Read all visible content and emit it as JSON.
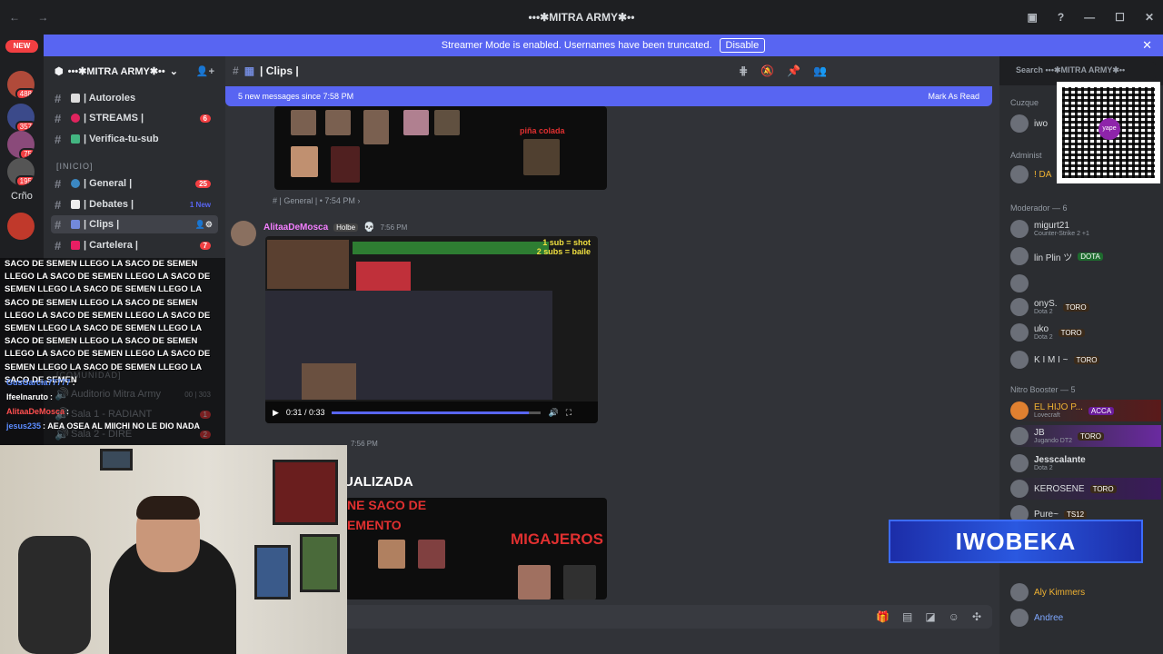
{
  "window": {
    "title": "•••✱MITRA ARMY✱••",
    "back": "←",
    "forward": "→"
  },
  "banner": {
    "text": "Streamer Mode is enabled. Usernames have been truncated.",
    "button": "Disable",
    "close": "✕"
  },
  "rail": {
    "new_label": "NEW",
    "servers": [
      {
        "badge": "488"
      },
      {
        "badge": "357"
      },
      {
        "badge": "75"
      },
      {
        "badge": "195"
      },
      {
        "label": "Crño"
      }
    ]
  },
  "guild": {
    "name": "•••✱MITRA ARMY✱••"
  },
  "channels": [
    {
      "name": "| Autoroles",
      "count": "",
      "new": ""
    },
    {
      "name": "| STREAMS |",
      "count": "6",
      "new": ""
    },
    {
      "name": "| Verifica-tu-sub",
      "count": "",
      "new": ""
    },
    {
      "name": "| General |",
      "count": "25",
      "new": ""
    },
    {
      "name": "| Debates |",
      "count": "",
      "new": "1 New"
    },
    {
      "name": "| Clips |",
      "count": "",
      "new": ""
    },
    {
      "name": "| Cartelera |",
      "count": "7",
      "new": ""
    }
  ],
  "categories": {
    "inicio": "[INICIO]",
    "comunidad": "[COMUNIDAD]"
  },
  "voice": [
    {
      "name": "Auditorio Mitra Army",
      "count": "00 | 303"
    },
    {
      "name": "Sala 1 - RADIANT",
      "count": "1"
    },
    {
      "name": "Sala 2 - DIRE",
      "count": "2"
    }
  ],
  "header": {
    "channel": "| Clips |",
    "search_placeholder": "Search •••✱MITRA ARMY✱••"
  },
  "new_messages": {
    "text": "5 new messages since 7:58 PM",
    "mark": "Mark As Read"
  },
  "messages": {
    "pina": "piña colada",
    "channel_link": "# | General | • 7:54 PM ›",
    "author": "AlitaaDeMosca",
    "author_tag": "Holbe",
    "time": "7:56 PM",
    "video_time": "0:31 / 0:33",
    "video_overlay_1": "1 sub = shot",
    "video_overlay_2": "2 subs = baile",
    "second_time": "7:56 PM",
    "second_heading": "UALIZADA",
    "second_sub": "NE SACO DE",
    "second_sub2": "EMENTO",
    "migajeros": "MIGAJEROS"
  },
  "members": {
    "categories": {
      "cuzquen": "Cuzque",
      "admin": "Administ",
      "mod": "Moderador — 6",
      "nitro": "Nitro Booster — 5"
    },
    "list": [
      {
        "name": "iwo",
        "sub": "",
        "tag": ""
      },
      {
        "name": "! DA",
        "sub": "",
        "tag": ""
      },
      {
        "name": "migurt21",
        "sub": "Counter-Strike 2 +1",
        "tag": ""
      },
      {
        "name": "lin Plin ツ",
        "sub": "",
        "tag": "DOTA"
      },
      {
        "name": "onyS.",
        "sub": "Dota 2",
        "tag": "TORO"
      },
      {
        "name": "uko",
        "sub": "Dota 2",
        "tag": "TORO"
      },
      {
        "name": "K I M I ~",
        "sub": "",
        "tag": "TORO"
      },
      {
        "name": "EL HIJO P...",
        "sub": "Lovecraft",
        "tag": "ACCA"
      },
      {
        "name": "JB",
        "sub": "Jugando DT2",
        "tag": "TORO"
      },
      {
        "name": "Jesscalante",
        "sub": "Dota 2",
        "tag": ""
      },
      {
        "name": "KEROSENE",
        "sub": "",
        "tag": "TORO"
      },
      {
        "name": "Pure~",
        "sub": "",
        "tag": "TS12"
      },
      {
        "name": "Aly Kimmers",
        "sub": "",
        "tag": ""
      },
      {
        "name": "Andree",
        "sub": "",
        "tag": ""
      }
    ]
  },
  "overlay": {
    "iwobeka": "IWOBEKA",
    "qr_logo": "yape",
    "spam": "SACO DE SEMEN LLEGO LA SACO DE SEMEN LLEGO LA SACO DE SEMEN LLEGO LA SACO DE SEMEN LLEGO LA SACO DE SEMEN LLEGO LA SACO DE SEMEN LLEGO LA SACO DE SEMEN LLEGO LA SACO DE SEMEN LLEGO LA SACO DE SEMEN LLEGO LA SACO DE SEMEN LLEGO LA SACO DE SEMEN LLEGO LA SACO DE SEMEN LLEGO LA SACO DE SEMEN LLEGO LA SACO DE SEMEN LLEGO LA SACO DE SEMEN LLEGO LA SACO DE SEMEN",
    "chat": [
      {
        "user": "GusGarcia77777",
        "msg": ":",
        "color": "#5b8cff"
      },
      {
        "user": "Ifeelnaruto",
        "msg": ":",
        "color": "#ffffff"
      },
      {
        "user": "AlitaaDeMosca",
        "msg": ":",
        "color": "#ff4f4f"
      },
      {
        "user": "jesus235",
        "msg": ": AEA OSEA AL MIICHI NO LE DIO NADA",
        "color": "#5b8cff"
      }
    ]
  }
}
